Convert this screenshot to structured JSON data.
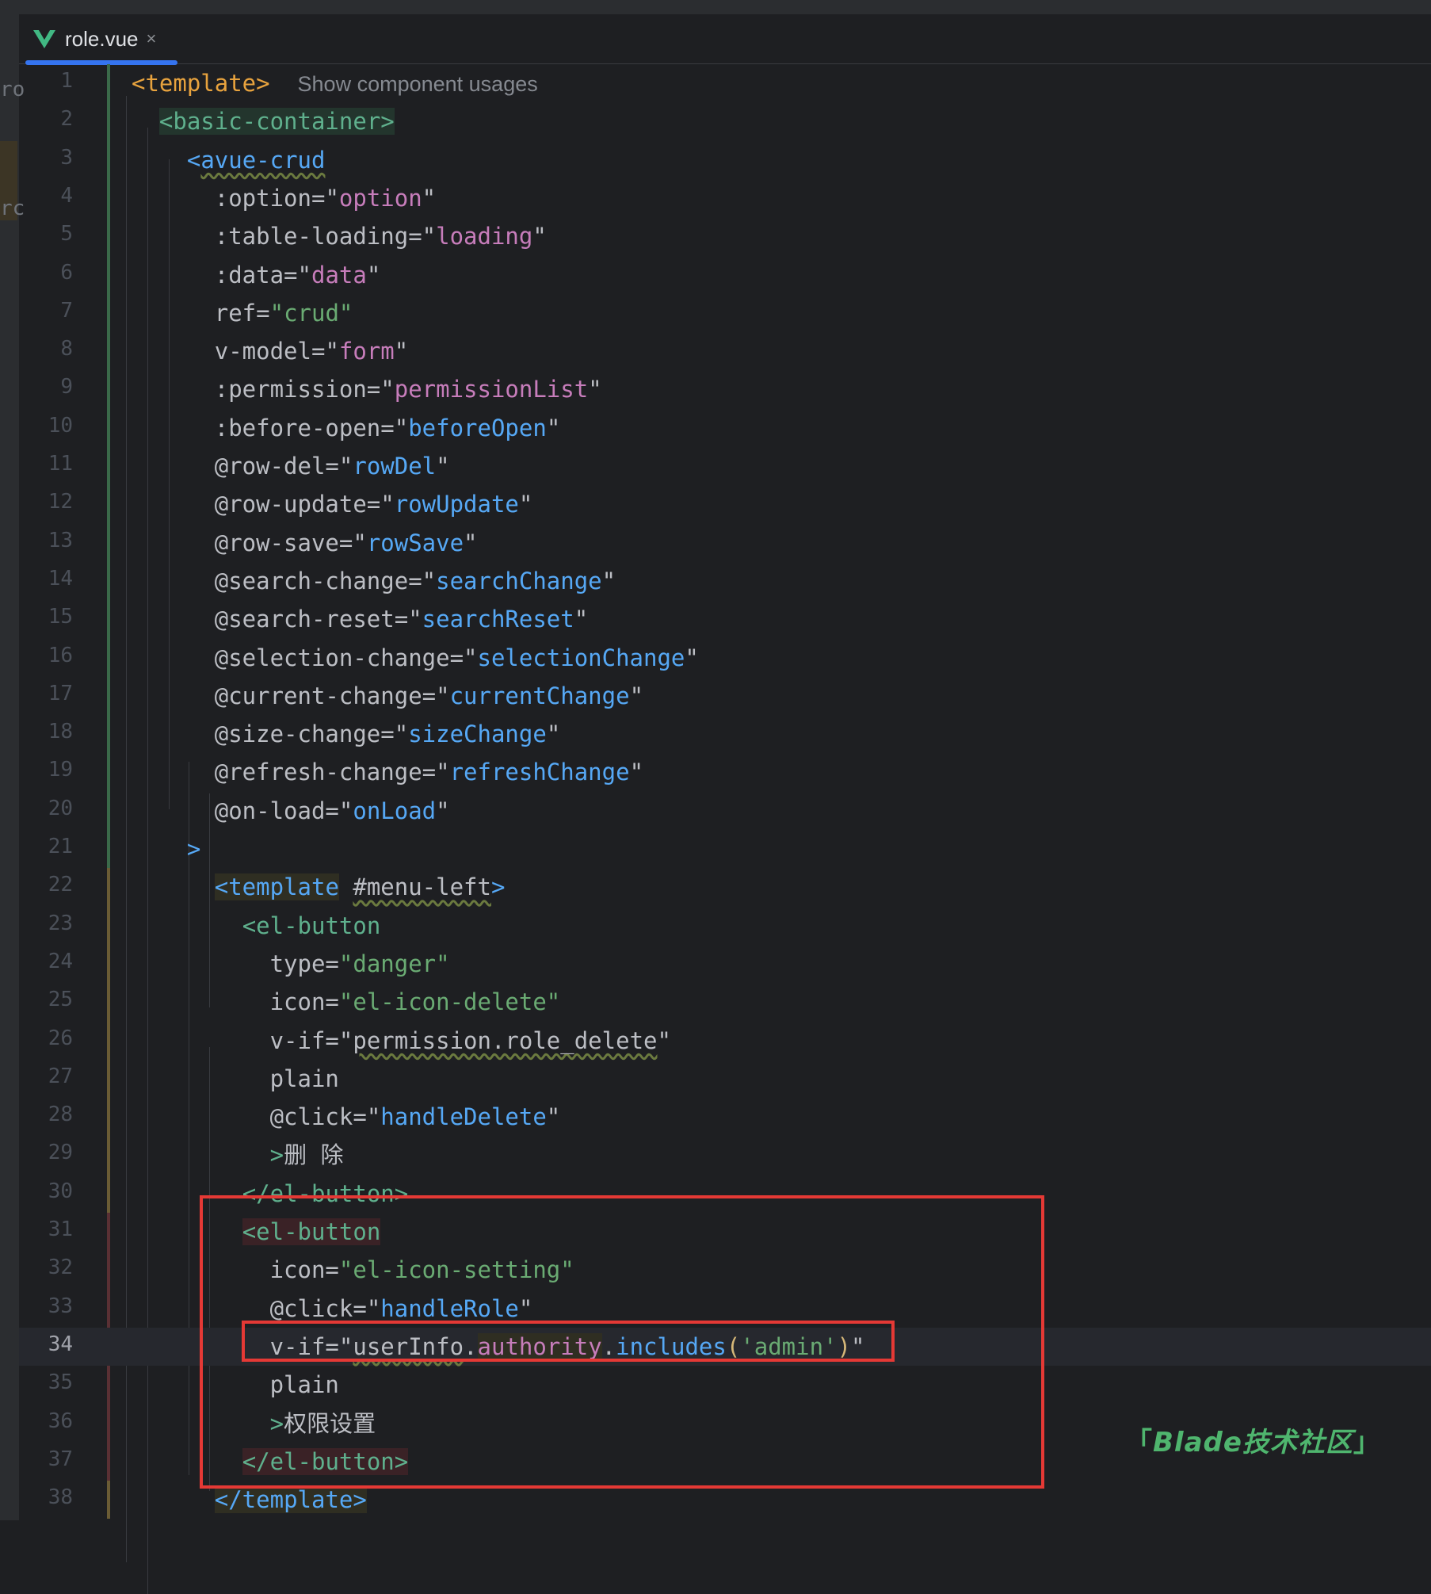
{
  "tab": {
    "name": "role.vue",
    "close": "×"
  },
  "left_fragments": [
    "ro",
    "rc"
  ],
  "current_line": 34,
  "hint": "Show component usages",
  "watermark": {
    "open": "「",
    "text": "Blade技术社区",
    "close": "」"
  },
  "lines": [
    {
      "n": "1",
      "segs": [
        [
          "<template>",
          "t-orange"
        ],
        [
          "  ",
          ""
        ],
        [
          "Show component usages",
          "t-hint"
        ]
      ]
    },
    {
      "n": "2",
      "segs": [
        [
          "  ",
          ""
        ],
        [
          "<basic-container>",
          "t-green bg-green"
        ]
      ]
    },
    {
      "n": "3",
      "segs": [
        [
          "    ",
          ""
        ],
        [
          "<",
          "t-blue"
        ],
        [
          "avue-crud",
          "t-blue wavy"
        ]
      ]
    },
    {
      "n": "4",
      "segs": [
        [
          "      :option=",
          ""
        ],
        [
          "\"",
          "t-attr"
        ],
        [
          "option",
          "t-purple"
        ],
        [
          "\"",
          ""
        ]
      ]
    },
    {
      "n": "5",
      "segs": [
        [
          "      :table-loading=",
          ""
        ],
        [
          "\"",
          ""
        ],
        [
          "loading",
          "t-purple"
        ],
        [
          "\"",
          ""
        ]
      ]
    },
    {
      "n": "6",
      "segs": [
        [
          "      :data=",
          ""
        ],
        [
          "\"",
          ""
        ],
        [
          "data",
          "t-purple"
        ],
        [
          "\"",
          ""
        ]
      ]
    },
    {
      "n": "7",
      "segs": [
        [
          "      ref=",
          ""
        ],
        [
          "\"crud\"",
          "t-str"
        ]
      ]
    },
    {
      "n": "8",
      "segs": [
        [
          "      v-model=",
          ""
        ],
        [
          "\"",
          ""
        ],
        [
          "form",
          "t-purple"
        ],
        [
          "\"",
          ""
        ]
      ]
    },
    {
      "n": "9",
      "segs": [
        [
          "      :permission=",
          ""
        ],
        [
          "\"",
          ""
        ],
        [
          "permissionList",
          "t-purple"
        ],
        [
          "\"",
          ""
        ]
      ]
    },
    {
      "n": "10",
      "segs": [
        [
          "      :before-open=",
          ""
        ],
        [
          "\"",
          ""
        ],
        [
          "beforeOpen",
          "t-blue"
        ],
        [
          "\"",
          ""
        ]
      ]
    },
    {
      "n": "11",
      "segs": [
        [
          "      @row-del=",
          ""
        ],
        [
          "\"",
          ""
        ],
        [
          "rowDel",
          "t-blue"
        ],
        [
          "\"",
          ""
        ]
      ]
    },
    {
      "n": "12",
      "segs": [
        [
          "      @row-update=",
          ""
        ],
        [
          "\"",
          ""
        ],
        [
          "rowUpdate",
          "t-blue"
        ],
        [
          "\"",
          ""
        ]
      ]
    },
    {
      "n": "13",
      "segs": [
        [
          "      @row-save=",
          ""
        ],
        [
          "\"",
          ""
        ],
        [
          "rowSave",
          "t-blue"
        ],
        [
          "\"",
          ""
        ]
      ]
    },
    {
      "n": "14",
      "segs": [
        [
          "      @search-change=",
          ""
        ],
        [
          "\"",
          ""
        ],
        [
          "searchChange",
          "t-blue"
        ],
        [
          "\"",
          ""
        ]
      ]
    },
    {
      "n": "15",
      "segs": [
        [
          "      @search-reset=",
          ""
        ],
        [
          "\"",
          ""
        ],
        [
          "searchReset",
          "t-blue"
        ],
        [
          "\"",
          ""
        ]
      ]
    },
    {
      "n": "16",
      "segs": [
        [
          "      @selection-change=",
          ""
        ],
        [
          "\"",
          ""
        ],
        [
          "selectionChange",
          "t-blue"
        ],
        [
          "\"",
          ""
        ]
      ]
    },
    {
      "n": "17",
      "segs": [
        [
          "      @current-change=",
          ""
        ],
        [
          "\"",
          ""
        ],
        [
          "currentChange",
          "t-blue"
        ],
        [
          "\"",
          ""
        ]
      ]
    },
    {
      "n": "18",
      "segs": [
        [
          "      @size-change=",
          ""
        ],
        [
          "\"",
          ""
        ],
        [
          "sizeChange",
          "t-blue"
        ],
        [
          "\"",
          ""
        ]
      ]
    },
    {
      "n": "19",
      "segs": [
        [
          "      @refresh-change=",
          ""
        ],
        [
          "\"",
          ""
        ],
        [
          "refreshChange",
          "t-blue"
        ],
        [
          "\"",
          ""
        ]
      ]
    },
    {
      "n": "20",
      "segs": [
        [
          "      @on-load=",
          ""
        ],
        [
          "\"",
          ""
        ],
        [
          "onLoad",
          "t-blue"
        ],
        [
          "\"",
          ""
        ]
      ]
    },
    {
      "n": "21",
      "segs": [
        [
          "    ",
          ""
        ],
        [
          ">",
          "t-blue"
        ]
      ]
    },
    {
      "n": "22",
      "segs": [
        [
          "      ",
          ""
        ],
        [
          "<template",
          "t-blue bg-olive"
        ],
        [
          " ",
          ""
        ],
        [
          "#menu-left",
          "wavy"
        ],
        [
          ">",
          "t-blue"
        ]
      ]
    },
    {
      "n": "23",
      "segs": [
        [
          "        ",
          ""
        ],
        [
          "<el-button",
          "t-green"
        ]
      ]
    },
    {
      "n": "24",
      "segs": [
        [
          "          type=",
          ""
        ],
        [
          "\"danger\"",
          "t-str"
        ]
      ]
    },
    {
      "n": "25",
      "segs": [
        [
          "          icon=",
          ""
        ],
        [
          "\"el-icon-delete\"",
          "t-str"
        ]
      ]
    },
    {
      "n": "26",
      "segs": [
        [
          "          v-if=",
          ""
        ],
        [
          "\"",
          ""
        ],
        [
          "permission.role_delete",
          "wavy"
        ],
        [
          "\"",
          ""
        ]
      ]
    },
    {
      "n": "27",
      "segs": [
        [
          "          plain",
          ""
        ]
      ]
    },
    {
      "n": "28",
      "segs": [
        [
          "          @click=",
          ""
        ],
        [
          "\"",
          ""
        ],
        [
          "handleDelete",
          "t-blue"
        ],
        [
          "\"",
          ""
        ]
      ]
    },
    {
      "n": "29",
      "segs": [
        [
          "          ",
          ""
        ],
        [
          ">",
          "t-green"
        ],
        [
          "删 除",
          ""
        ]
      ]
    },
    {
      "n": "30",
      "segs": [
        [
          "        ",
          ""
        ],
        [
          "</el-button>",
          "t-green"
        ]
      ]
    },
    {
      "n": "31",
      "segs": [
        [
          "        ",
          ""
        ],
        [
          "<el-button",
          "t-green bg-red"
        ]
      ]
    },
    {
      "n": "32",
      "segs": [
        [
          "          icon=",
          ""
        ],
        [
          "\"el-icon-setting\"",
          "t-str"
        ]
      ]
    },
    {
      "n": "33",
      "segs": [
        [
          "          @click=",
          ""
        ],
        [
          "\"",
          ""
        ],
        [
          "handleRole",
          "t-blue"
        ],
        [
          "\"",
          ""
        ]
      ]
    },
    {
      "n": "34",
      "segs": [
        [
          "          v-if=",
          ""
        ],
        [
          "\"",
          ""
        ],
        [
          "userInfo",
          "wavy"
        ],
        [
          ".",
          ""
        ],
        [
          "authority",
          "t-purple bg-olive"
        ],
        [
          ".",
          ""
        ],
        [
          "includes",
          "t-blue"
        ],
        [
          "(",
          "t-yellow"
        ],
        [
          "'admin'",
          "t-str"
        ],
        [
          ")",
          "t-yellow"
        ],
        [
          "\"",
          ""
        ]
      ]
    },
    {
      "n": "35",
      "segs": [
        [
          "          plain",
          ""
        ]
      ]
    },
    {
      "n": "36",
      "segs": [
        [
          "          ",
          ""
        ],
        [
          ">",
          "t-green"
        ],
        [
          "权限设置",
          ""
        ]
      ]
    },
    {
      "n": "37",
      "segs": [
        [
          "        ",
          ""
        ],
        [
          "</el-button>",
          "t-green bg-red"
        ]
      ]
    },
    {
      "n": "38",
      "segs": [
        [
          "      ",
          ""
        ],
        [
          "</template>",
          "t-blue bg-olive"
        ]
      ]
    }
  ]
}
